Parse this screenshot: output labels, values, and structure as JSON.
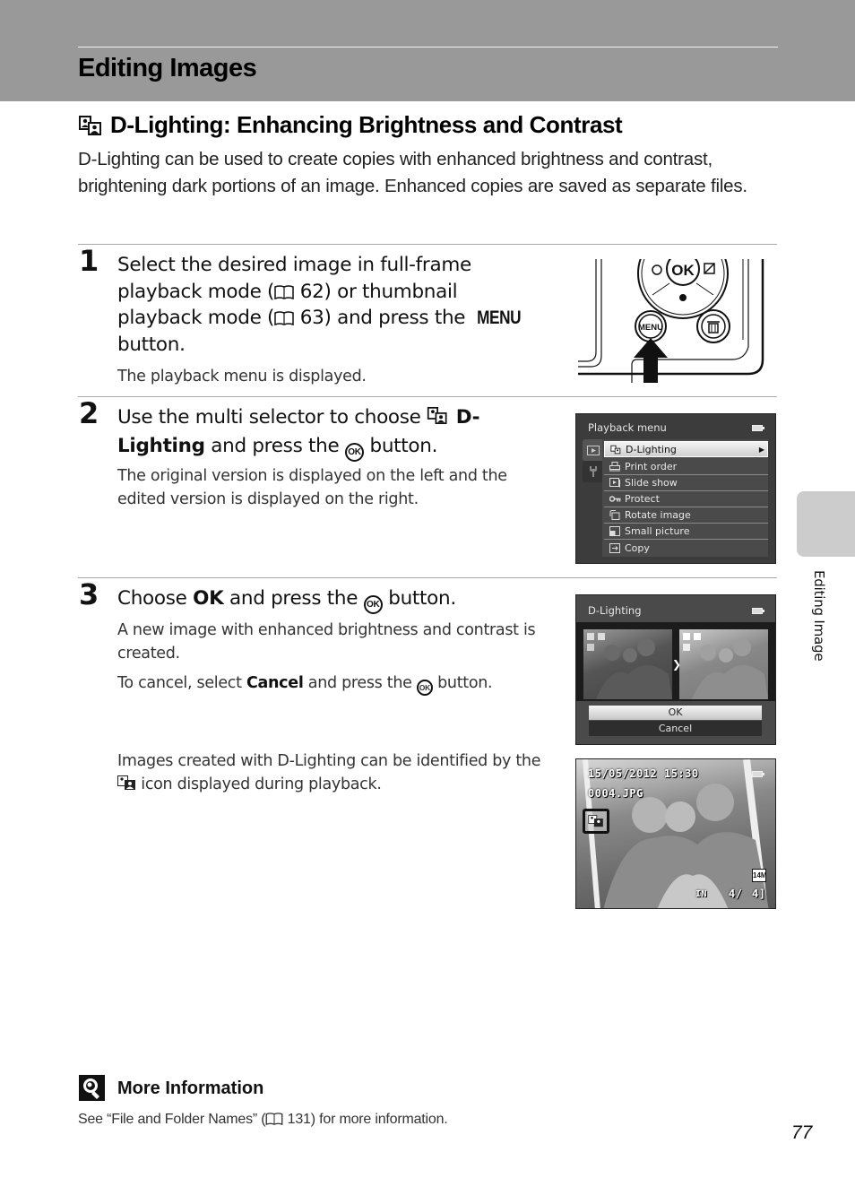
{
  "header": {
    "title": "Editing Images"
  },
  "section": {
    "icon": "d-lighting-icon",
    "title": "D-Lighting: Enhancing Brightness and Contrast",
    "intro": "D-Lighting can be used to create copies with enhanced brightness and contrast, brightening dark portions of an image. Enhanced copies are saved as separate files."
  },
  "steps": [
    {
      "number": "1",
      "heading_line1": "Select the desired image in full-frame",
      "heading_line2a": "playback mode (",
      "heading_line2_ref": "62",
      "heading_line2b": ") or thumbnail",
      "heading_line3a": "playback mode (",
      "heading_line3_ref": "63",
      "heading_line3b": ") and press the ",
      "heading_line3_key": "MENU",
      "heading_line4": "button.",
      "body": "The playback menu is displayed.",
      "illustration": {
        "ok_label": "OK",
        "menu_label": "MENU"
      }
    },
    {
      "number": "2",
      "heading_a": "Use the multi selector to choose ",
      "heading_bold1": "D-",
      "heading_bold2": "Lighting",
      "heading_b": " and press the ",
      "heading_key": "OK",
      "heading_c": " button.",
      "body": "The original version is displayed on the left and the edited version is displayed on the right.",
      "screen": {
        "title": "Playback menu",
        "items": [
          {
            "icon": "d-lighting-icon",
            "label": "D-Lighting",
            "selected": true
          },
          {
            "icon": "print-order-icon",
            "label": "Print order"
          },
          {
            "icon": "slide-show-icon",
            "label": "Slide show"
          },
          {
            "icon": "protect-key-icon",
            "label": "Protect"
          },
          {
            "icon": "rotate-image-icon",
            "label": "Rotate image"
          },
          {
            "icon": "small-picture-icon",
            "label": "Small picture"
          },
          {
            "icon": "copy-icon",
            "label": "Copy"
          }
        ]
      }
    },
    {
      "number": "3",
      "heading_a": "Choose ",
      "heading_bold": "OK",
      "heading_b": " and press the ",
      "heading_key": "OK",
      "heading_c": " button.",
      "body1": "A new image with enhanced brightness and contrast is created.",
      "body2a": "To cancel, select ",
      "body2_bold": "Cancel",
      "body2b": " and press the ",
      "body2_key": "OK",
      "body2c": " button.",
      "screen": {
        "title": "D-Lighting",
        "ok_label": "OK",
        "cancel_label": "Cancel"
      }
    }
  ],
  "note": {
    "text_line1": "Images created with D-Lighting can be identified by the",
    "text_line2": " icon displayed during playback.",
    "screen": {
      "datetime": "15/05/2012 15:30",
      "filename": "0004.JPG",
      "image_size": "14M",
      "storage": "IN",
      "frame": "4/",
      "total": "4]"
    }
  },
  "more_info": {
    "title": "More Information",
    "text_a": "See “File and Folder Names” (",
    "ref": "131",
    "text_b": ") for more information."
  },
  "side_tab": {
    "label": "Editing Image"
  },
  "page_number": "77"
}
